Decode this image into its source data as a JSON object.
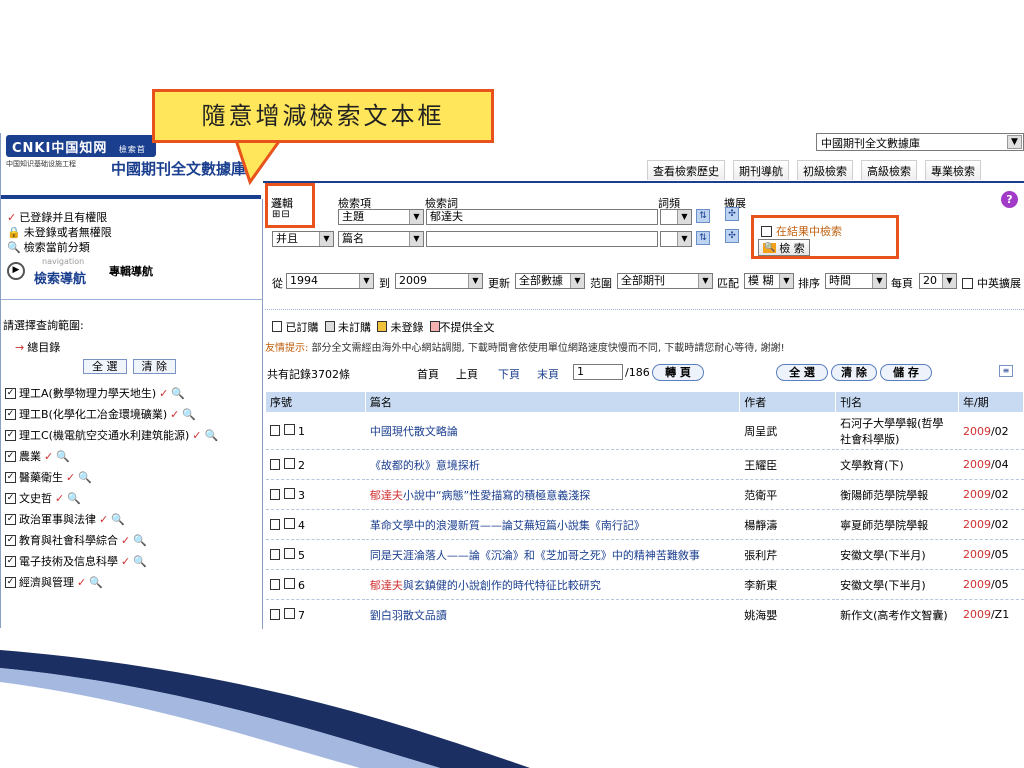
{
  "callout": {
    "text": "隨意增減檢索文本框"
  },
  "header": {
    "logo_text": "CNKI中国知网",
    "logo_url": "www.cnki.net",
    "logo_tab": "檢索首頁",
    "logo_sub": "中国知识基础设施工程",
    "title": "中國期刊全文數據庫",
    "db_select": "中國期刊全文數據庫",
    "tabs": [
      "查看檢索歷史",
      "期刊導航",
      "初級檢索",
      "高級檢索",
      "專業檢索"
    ]
  },
  "sidebar": {
    "access": [
      "已登錄并且有權限",
      "未登錄或者無權限",
      "檢索當前分類"
    ],
    "nav_small": "navigation",
    "nav_label": "檢索導航",
    "nav_special": "專輯導航",
    "scope_label": "請選擇查詢範圍:",
    "catalog": "總目錄",
    "select_all": "全 選",
    "clear": "清 除",
    "categories": [
      "理工A(數學物理力學天地生)",
      "理工B(化學化工冶金環境礦業)",
      "理工C(機電航空交通水利建筑能源)",
      "農業",
      "醫藥衛生",
      "文史哲",
      "政治軍事與法律",
      "教育與社會科學綜合",
      "電子技術及信息科學",
      "經濟與管理"
    ]
  },
  "search": {
    "h_logic": "邏輯",
    "h_field": "檢索項",
    "h_term": "檢索詞",
    "h_freq": "詞頻",
    "h_expand": "擴展",
    "row1_field": "主題",
    "row1_term": "郁達夫",
    "row2_logic": "并且",
    "row2_field": "篇名",
    "in_results": "在結果中檢索",
    "search_btn": "檢 索",
    "from_label": "從",
    "from_year": "1994",
    "to_label": "到",
    "to_year": "2009",
    "update_label": "更新",
    "update_val": "全部數據",
    "scope_label": "范圍",
    "scope_val": "全部期刊",
    "match_label": "匹配",
    "match_val": "模 糊",
    "sort_label": "排序",
    "sort_val": "時間",
    "per_label": "每頁",
    "per_val": "20",
    "expand_label": "中英擴展"
  },
  "legend": {
    "ordered": "已訂購",
    "not_ordered": "未訂購",
    "not_logged": "未登錄",
    "not_provided": "不提供全文",
    "tip_label": "友情提示:",
    "tip_text": "部分全文需經由海外中心網站調閱, 下載時間會依使用單位網路速度快慢而不同, 下載時請您耐心等待, 謝謝!"
  },
  "pager": {
    "total": "共有記錄3702條",
    "first": "首頁",
    "prev": "上頁",
    "next": "下頁",
    "last": "末頁",
    "page": "1",
    "pages": "/186",
    "go": "轉 頁",
    "select_all": "全 選",
    "clear": "清 除",
    "save": "儲 存"
  },
  "table": {
    "headers": [
      "序號",
      "篇名",
      "作者",
      "刊名",
      "年/期"
    ],
    "rows": [
      {
        "no": "1",
        "pre": "",
        "hit": "",
        "title": "中國現代散文略論",
        "author": "周呈武",
        "journal": "石河子大學學報(哲學社會科學版)",
        "year": "2009",
        "issue": "/02"
      },
      {
        "no": "2",
        "pre": "",
        "hit": "",
        "title": "《故都的秋》意境探析",
        "author": "王耀臣",
        "journal": "文學教育(下)",
        "year": "2009",
        "issue": "/04"
      },
      {
        "no": "3",
        "pre": "",
        "hit": "郁達夫",
        "title": "小說中“病態”性愛描寫的積極意義淺探",
        "author": "范衛平",
        "journal": "衡陽師范學院學報",
        "year": "2009",
        "issue": "/02"
      },
      {
        "no": "4",
        "pre": "",
        "hit": "",
        "title": "革命文學中的浪漫新質——論艾蕪短篇小說集《南行記》",
        "author": "楊靜濤",
        "journal": "寧夏師范學院學報",
        "year": "2009",
        "issue": "/02"
      },
      {
        "no": "5",
        "pre": "",
        "hit": "",
        "title": "同是天涯淪落人——論《沉淪》和《芝加哥之死》中的精神苦難敘事",
        "author": "張利芹",
        "journal": "安徽文學(下半月)",
        "year": "2009",
        "issue": "/05"
      },
      {
        "no": "6",
        "pre": "",
        "hit": "郁達夫",
        "title": "與玄鎮健的小說創作的時代特征比較研究",
        "author": "李新東",
        "journal": "安徽文學(下半月)",
        "year": "2009",
        "issue": "/05"
      },
      {
        "no": "7",
        "pre": "",
        "hit": "",
        "title": "劉白羽散文品讀",
        "author": "姚海嬰",
        "journal": "新作文(高考作文智囊)",
        "year": "2009",
        "issue": "/Z1"
      }
    ]
  },
  "colors": {
    "accent": "#1b3f8f",
    "highlight": "#e8521c",
    "callout_bg": "#ffe65a",
    "header_row": "#c8daf2",
    "red": "#d03030"
  }
}
